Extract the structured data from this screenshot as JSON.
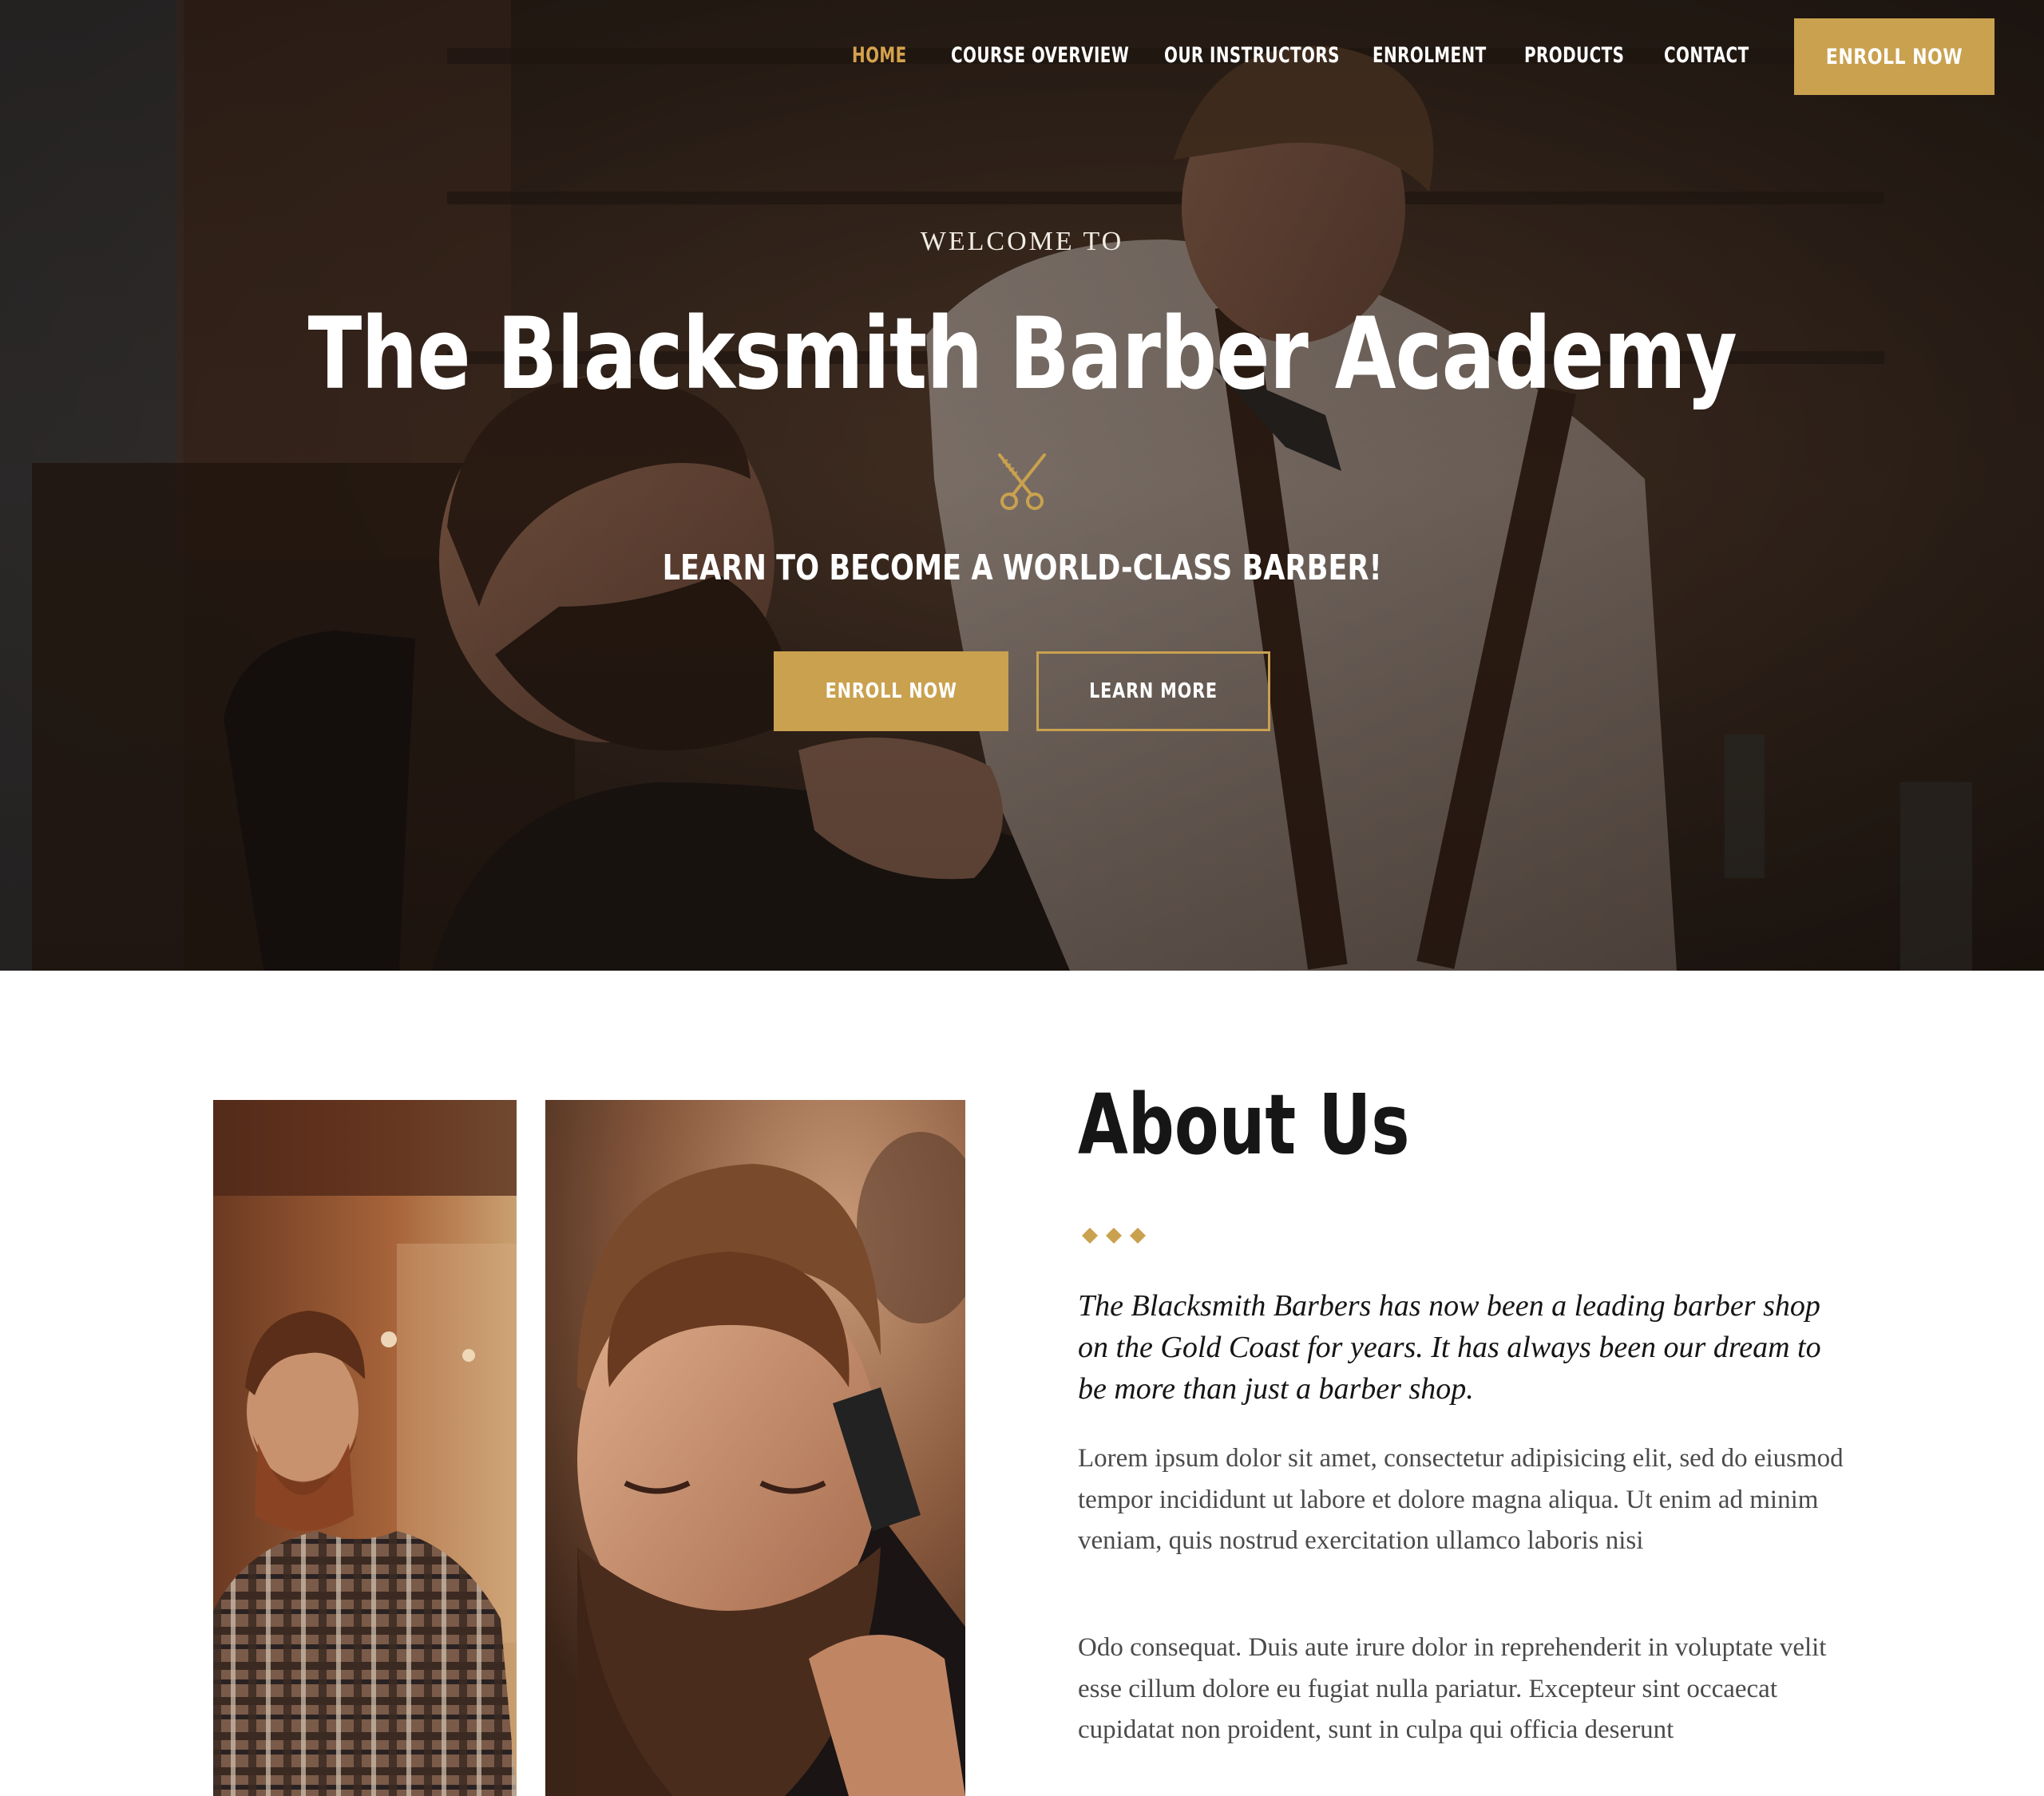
{
  "nav": {
    "items": [
      {
        "label": "HOME",
        "active": true
      },
      {
        "label": "COURSE OVERVIEW",
        "active": false
      },
      {
        "label": "OUR INSTRUCTORS",
        "active": false
      },
      {
        "label": "ENROLMENT",
        "active": false
      },
      {
        "label": "PRODUCTS",
        "active": false
      },
      {
        "label": "CONTACT",
        "active": false
      }
    ],
    "cta_label": "ENROLL NOW"
  },
  "hero": {
    "welcome": "WELCOME TO",
    "title": "The Blacksmith Barber Academy",
    "icon": "scissors-icon",
    "tagline": "LEARN TO BECOME A WORLD-CLASS BARBER!",
    "enroll_label": "ENROLL NOW",
    "learn_label": "LEARN MORE"
  },
  "about": {
    "title": "About Us",
    "lead": "The Blacksmith Barbers has now been a leading barber shop on the Gold Coast for years. It has always been our dream to be more than just a barber shop.",
    "paragraph1": "Lorem ipsum dolor sit amet, consectetur adipisicing elit, sed do eiusmod tempor incididunt ut labore et dolore magna aliqua. Ut enim ad minim veniam, quis nostrud exercitation ullamco laboris nisi",
    "paragraph2": "Odo consequat. Duis aute irure dolor in reprehenderit in voluptate velit esse cillum dolore eu fugiat nulla pariatur. Excepteur sint occaecat cupidatat non proident, sunt in culpa qui officia deserunt"
  },
  "colors": {
    "accent": "#c9a14f",
    "nav_active": "#d4a24e",
    "hero_dark": "#2a1f18",
    "heading": "#161616",
    "body_text": "#4a4a4a"
  }
}
